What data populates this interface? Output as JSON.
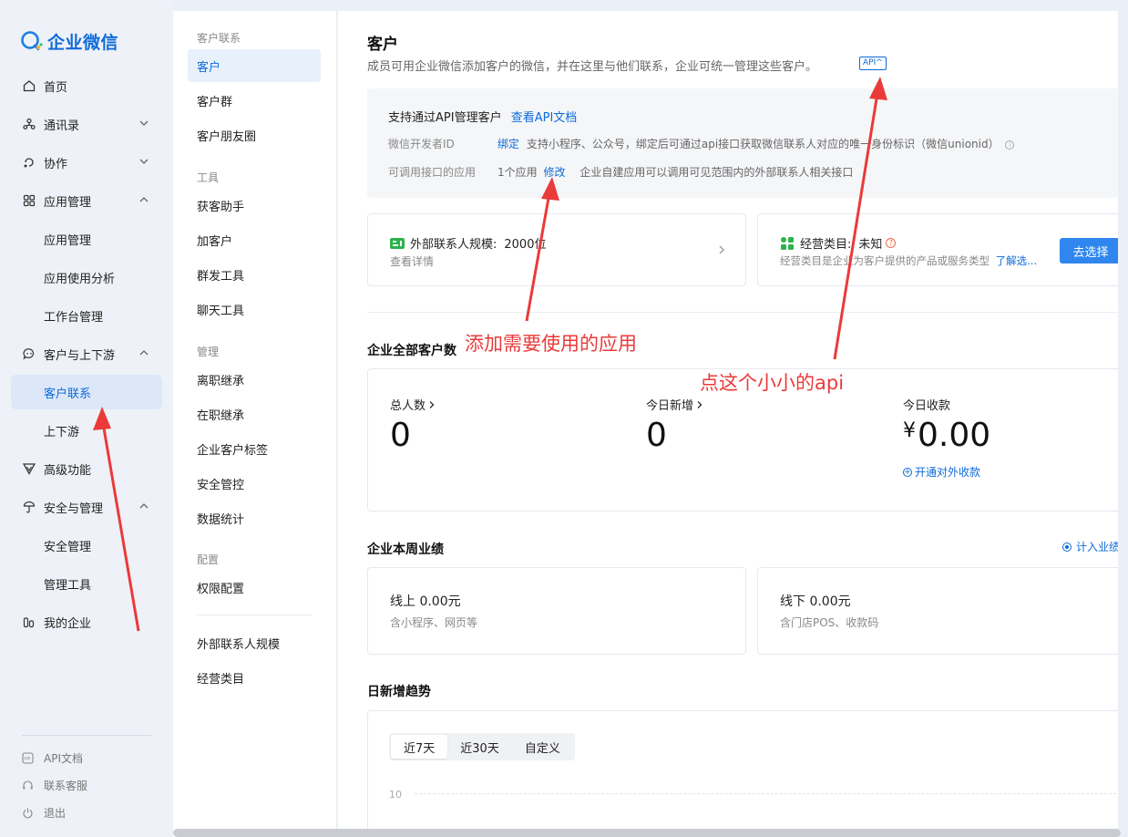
{
  "brand": {
    "name": "企业微信",
    "color": "#0e6bd8"
  },
  "nav": {
    "items": [
      {
        "label": "首页",
        "icon": "home-icon"
      },
      {
        "label": "通讯录",
        "icon": "contacts-icon"
      },
      {
        "label": "协作",
        "icon": "collaboration-icon"
      },
      {
        "label": "应用管理",
        "icon": "apps-icon"
      },
      {
        "label": "应用管理"
      },
      {
        "label": "应用使用分析"
      },
      {
        "label": "工作台管理"
      },
      {
        "label": "客户与上下游",
        "icon": "customer-chat-icon"
      },
      {
        "label": "客户联系",
        "active": true
      },
      {
        "label": "上下游"
      },
      {
        "label": "高级功能",
        "icon": "advanced-icon"
      },
      {
        "label": "安全与管理",
        "icon": "security-icon"
      },
      {
        "label": "安全管理"
      },
      {
        "label": "管理工具"
      },
      {
        "label": "我的企业",
        "icon": "enterprise-icon"
      }
    ],
    "footer": [
      {
        "label": "API文档",
        "icon": "api-doc-icon"
      },
      {
        "label": "联系客服",
        "icon": "headset-icon"
      },
      {
        "label": "退出",
        "icon": "power-icon"
      }
    ]
  },
  "submenu": {
    "groups": [
      "客户联系",
      "工具",
      "管理",
      "配置"
    ],
    "items": [
      "客户",
      "客户群",
      "客户朋友圈",
      "获客助手",
      "加客户",
      "群发工具",
      "聊天工具",
      "离职继承",
      "在职继承",
      "企业客户标签",
      "安全管控",
      "数据统计",
      "权限配置",
      "外部联系人规模",
      "经营类目"
    ]
  },
  "main": {
    "title": "客户",
    "desc": "成员可用企业微信添加客户的微信，并在这里与他们联系，企业可统一管理这些客户。",
    "api_tag": "API",
    "api_box": {
      "head": "支持通过API管理客户",
      "head_link": "查看API文档",
      "row1_label": "微信开发者ID",
      "row1_link": "绑定",
      "row1_text": "支持小程序、公众号，绑定后可通过api接口获取微信联系人对应的唯一身份标识（微信unionid）",
      "row2_label": "可调用接口的应用",
      "row2_count": "1个应用",
      "row2_link": "修改",
      "row2_text": "企业自建应用可以调用可见范围内的外部联系人相关接口"
    },
    "scale_card": {
      "title": "外部联系人规模:",
      "value": "2000位",
      "sub": "查看详情"
    },
    "category_card": {
      "title": "经营类目:",
      "value": "未知",
      "sub": "经营类目是企业为客户提供的产品或服务类型",
      "sub_link": "了解选...",
      "button": "去选择"
    },
    "all_customers": {
      "title": "企业全部客户数",
      "total_label": "总人数",
      "total_value": "0",
      "today_label": "今日新增",
      "today_value": "0",
      "income_label": "今日收款",
      "income_currency": "¥",
      "income_value": "0.00",
      "income_link": "开通对外收款"
    },
    "weekly": {
      "title": "企业本周业绩",
      "link": "计入业绩",
      "online_title": "线上 0.00元",
      "online_sub": "含小程序、网页等",
      "offline_title": "线下 0.00元",
      "offline_sub": "含门店POS、收款码"
    },
    "trend": {
      "title": "日新增趋势",
      "tabs": [
        "近7天",
        "近30天",
        "自定义"
      ],
      "active_tab": 0,
      "y_tick": "10"
    }
  },
  "annotations": {
    "app_hint": "添加需要使用的应用",
    "api_hint": "点这个小小的api",
    "color": "#ea3a3a"
  }
}
